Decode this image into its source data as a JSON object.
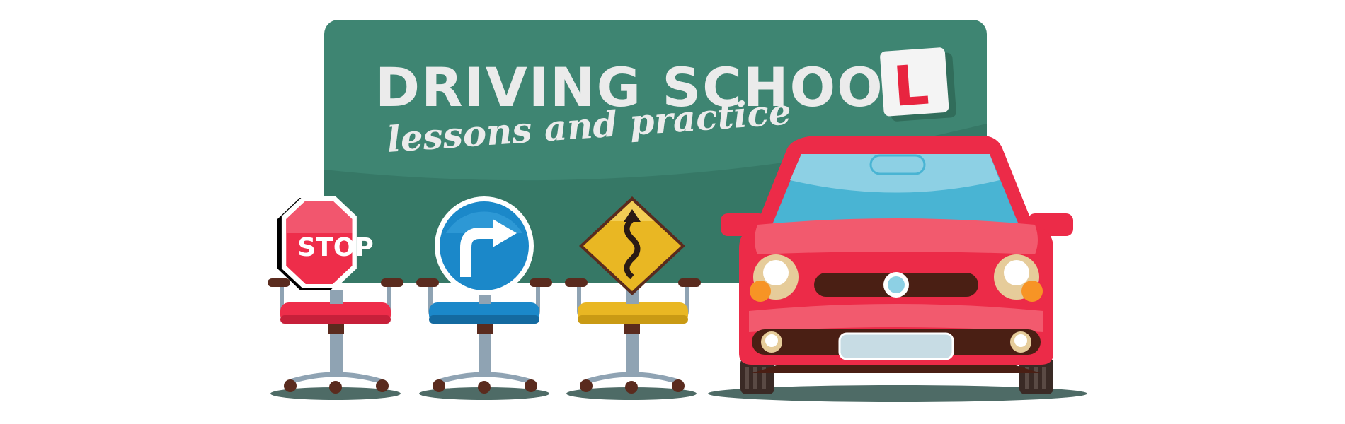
{
  "banner": {
    "title": "DRIVING SCHOO",
    "subtitle": "lessons and practice",
    "learner_plate": "L"
  },
  "signs": {
    "stop": "STOP",
    "turn_right": "turn-right-arrow-icon",
    "winding_road": "winding-road-icon"
  },
  "colors": {
    "board": "#3e8572",
    "board_shadow": "#2f6e5c",
    "car_red": "#ec2b48",
    "sign_red": "#ee2d4a",
    "sign_blue": "#1b88c9",
    "sign_yellow": "#e9b723",
    "window_blue": "#49b4d3",
    "learner_red": "#e8243f"
  }
}
